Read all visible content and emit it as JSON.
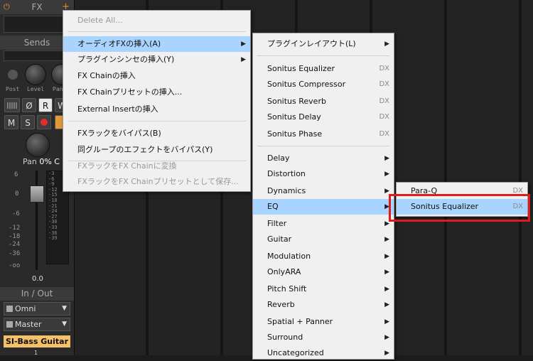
{
  "strip": {
    "fx_label": "FX",
    "sends_label": "Sends",
    "knob_labels": [
      "Post",
      "Level",
      "Pan"
    ],
    "pan_label": "Pan",
    "pan_value": "0% C",
    "fader_scale": [
      "6",
      "0",
      "-6",
      "-12",
      "-18",
      "-24",
      "-36",
      "-oo"
    ],
    "meter_scale": [
      "-3",
      "-6",
      "-9",
      "-12",
      "-15",
      "-18",
      "-21",
      "-24",
      "-27",
      "-30",
      "-33",
      "-36",
      "-39"
    ],
    "level_readout": "0.0",
    "buttons": {
      "r": "R",
      "w": "W",
      "m": "M",
      "s": "S",
      "phase": "Ø"
    },
    "io_label": "In / Out",
    "input": "Omni",
    "output": "Master",
    "track_name": "SI-Bass Guitar",
    "track_number": "1"
  },
  "menu1": {
    "items": [
      {
        "label": "Delete All..."
      },
      {
        "label": "オーディオFXの挿入(A)"
      },
      {
        "label": "プラグインシンセの挿入(Y)"
      },
      {
        "label": "FX Chainの挿入"
      },
      {
        "label": "FX Chainプリセットの挿入..."
      },
      {
        "label": "External Insertの挿入"
      },
      {
        "label": "FXラックをバイパス(B)"
      },
      {
        "label": "同グループのエフェクトをバイパス(Y)"
      },
      {
        "label": "FXラックをFX Chainに変換"
      },
      {
        "label": "FXラックをFX Chainプリセットとして保存..."
      }
    ]
  },
  "menu2": {
    "items": [
      {
        "label": "プラグインレイアウト(L)"
      },
      {
        "label": "Sonitus Equalizer",
        "tag": "DX"
      },
      {
        "label": "Sonitus Compressor",
        "tag": "DX"
      },
      {
        "label": "Sonitus Reverb",
        "tag": "DX"
      },
      {
        "label": "Sonitus Delay",
        "tag": "DX"
      },
      {
        "label": "Sonitus Phase",
        "tag": "DX"
      },
      {
        "label": "Delay"
      },
      {
        "label": "Distortion"
      },
      {
        "label": "Dynamics"
      },
      {
        "label": "EQ"
      },
      {
        "label": "Filter"
      },
      {
        "label": "Guitar"
      },
      {
        "label": "Modulation"
      },
      {
        "label": "OnlyARA"
      },
      {
        "label": "Pitch Shift"
      },
      {
        "label": "Reverb"
      },
      {
        "label": "Spatial + Panner"
      },
      {
        "label": "Surround"
      },
      {
        "label": "Uncategorized"
      }
    ]
  },
  "menu3": {
    "items": [
      {
        "label": "Para-Q",
        "tag": "DX"
      },
      {
        "label": "Sonitus Equalizer",
        "tag": "DX"
      }
    ]
  },
  "colors": {
    "highlight": "#a8d4ff",
    "callout": "#e01b1b",
    "track_name_bg": "#f4c06a"
  }
}
